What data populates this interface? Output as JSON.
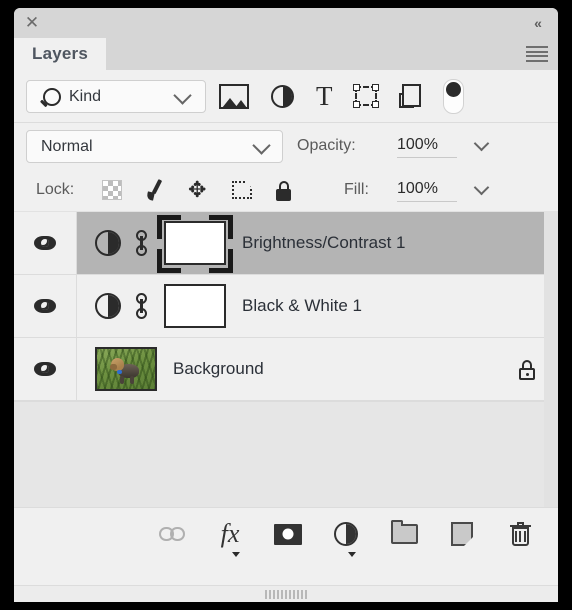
{
  "panel": {
    "title": "Layers",
    "close_icon": "close-x-icon",
    "collapse_icon": "double-chevron-left-icon",
    "menu_icon": "hamburger-menu-icon"
  },
  "filter_bar": {
    "kind_label": "Kind",
    "search_icon": "magnifier-icon",
    "dropdown_icon": "chevron-down-icon",
    "type_filters": [
      {
        "name": "filter-pixel-layers",
        "icon": "image-icon",
        "label": "Pixel layers"
      },
      {
        "name": "filter-adjustment-layers",
        "icon": "half-circle-adjustment-icon",
        "label": "Adjustment layers"
      },
      {
        "name": "filter-type-layers",
        "icon": "text-t-icon",
        "label": "Type layers"
      },
      {
        "name": "filter-shape-layers",
        "icon": "shape-bounding-box-icon",
        "label": "Shape layers"
      },
      {
        "name": "filter-smart-objects",
        "icon": "smart-object-icon",
        "label": "Smart objects"
      }
    ],
    "toggle": {
      "name": "filter-enable-toggle",
      "state": "off"
    }
  },
  "blend_bar": {
    "blend_mode": "Normal",
    "opacity_label": "Opacity:",
    "opacity_value": "100%",
    "dropdown_icon": "chevron-down-icon"
  },
  "lock_bar": {
    "lock_label": "Lock:",
    "lock_buttons": [
      {
        "name": "lock-transparent-pixels",
        "icon": "checkerboard-icon"
      },
      {
        "name": "lock-image-pixels",
        "icon": "paintbrush-icon"
      },
      {
        "name": "lock-position",
        "icon": "move-arrows-icon"
      },
      {
        "name": "lock-artboard-nesting",
        "icon": "artboard-icon"
      },
      {
        "name": "lock-all",
        "icon": "padlock-icon"
      }
    ],
    "fill_label": "Fill:",
    "fill_value": "100%"
  },
  "layers": [
    {
      "name": "Brightness/Contrast 1",
      "visible": true,
      "selected": true,
      "thumb_type": "adjustment",
      "has_link": true,
      "mask": {
        "type": "white-mask",
        "selected": true
      },
      "locked": false
    },
    {
      "name": "Black & White 1",
      "visible": true,
      "selected": false,
      "thumb_type": "adjustment",
      "has_link": true,
      "mask": {
        "type": "white-mask",
        "selected": false
      },
      "locked": false
    },
    {
      "name": "Background",
      "visible": true,
      "selected": false,
      "thumb_type": "photo",
      "thumb_description": "yorkshire-terrier-on-grass",
      "has_link": false,
      "locked": true
    }
  ],
  "bottom_toolbar": [
    {
      "name": "link-layers-button",
      "icon": "chain-link-icon",
      "label": "Link layers",
      "disabled": true,
      "caret": false
    },
    {
      "name": "layer-style-button",
      "icon": "fx-icon",
      "label": "Add a layer style",
      "disabled": false,
      "caret": true
    },
    {
      "name": "add-layer-mask-button",
      "icon": "layer-mask-icon",
      "label": "Add layer mask",
      "disabled": false,
      "caret": false
    },
    {
      "name": "new-adjustment-layer-button",
      "icon": "half-circle-adjustment-icon",
      "label": "Create new fill or adjustment layer",
      "disabled": false,
      "caret": true
    },
    {
      "name": "new-group-button",
      "icon": "folder-icon",
      "label": "Create a new group",
      "disabled": false,
      "caret": false
    },
    {
      "name": "new-layer-button",
      "icon": "new-page-icon",
      "label": "Create a new layer",
      "disabled": false,
      "caret": false
    },
    {
      "name": "delete-layer-button",
      "icon": "trash-can-icon",
      "label": "Delete layer",
      "disabled": false,
      "caret": false
    }
  ],
  "colors": {
    "panel_bg": "#f0f0f0",
    "titlebar_bg": "#d6d6d6",
    "selected_row": "#b4b4b4",
    "empty_area": "#e6e6e6",
    "text": "#2b3038",
    "muted_text": "#5a5a5a"
  }
}
